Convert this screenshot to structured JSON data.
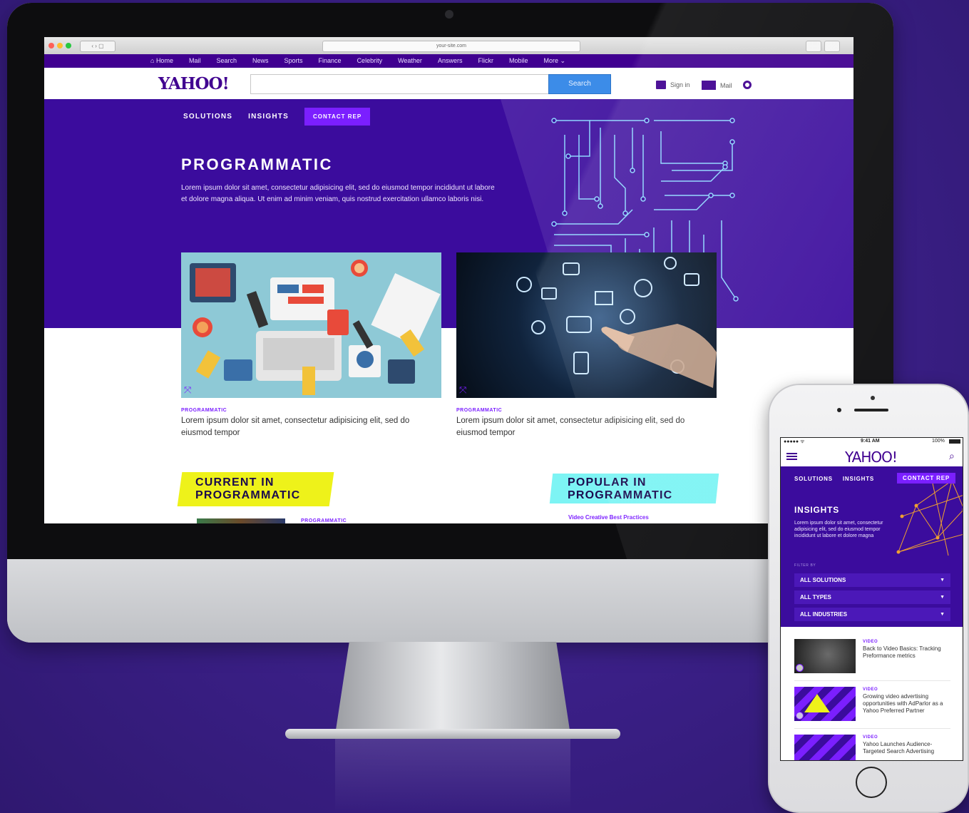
{
  "colors": {
    "brand_purple": "#400090",
    "hero_purple": "#3b0c9d",
    "accent_violet": "#7b1fff",
    "search_blue": "#3c8ce8",
    "highlight_yellow": "#eef21a",
    "highlight_cyan": "#7df4f4"
  },
  "desktop": {
    "browser": {
      "url": "your-site.com"
    },
    "yahoo_nav": {
      "items": [
        "Home",
        "Mail",
        "Search",
        "News",
        "Sports",
        "Finance",
        "Celebrity",
        "Weather",
        "Answers",
        "Flickr",
        "Mobile",
        "More ⌄"
      ]
    },
    "header": {
      "logo": "YAHOO!",
      "search_placeholder": "",
      "search_button": "Search",
      "sign_in": "Sign in",
      "mail": "Mail"
    },
    "subnav": {
      "solutions": "SOLUTIONS",
      "insights": "INSIGHTS",
      "contact": "CONTACT REP"
    },
    "hero": {
      "title": "PROGRAMMATIC",
      "body": "Lorem ipsum dolor sit amet, consectetur adipisicing elit, sed do eiusmod tempor incididunt ut labore et dolore magna aliqua. Ut enim ad minim veniam, quis nostrud exercitation ullamco laboris nisi."
    },
    "cards": [
      {
        "tag": "PROGRAMMATIC",
        "desc": "Lorem ipsum dolor sit amet, consectetur adipisicing elit, sed do eiusmod tempor"
      },
      {
        "tag": "PROGRAMMATIC",
        "desc": "Lorem ipsum dolor sit amet, consectetur adipisicing elit, sed do eiusmod tempor"
      }
    ],
    "current": {
      "title_1": "CURRENT IN",
      "title_2": "PROGRAMMATIC",
      "item_tag": "PROGRAMMATIC"
    },
    "popular": {
      "title_1": "POPULAR IN",
      "title_2": "PROGRAMMATIC",
      "first_link": "Video Creative Best Practices"
    }
  },
  "mobile": {
    "status": {
      "carrier": "●●●●● ᯤ",
      "time": "9:41 AM",
      "battery": "100%"
    },
    "logo": "YAHOO!",
    "subnav": {
      "solutions": "SOLUTIONS",
      "insights": "INSIGHTS",
      "contact": "CONTACT REP"
    },
    "hero": {
      "title": "INSIGHTS",
      "body": "Lorem ipsum dolor sit amet, consectetur adipisicing elit, sed do eiusmod tempor incididunt ut labore et dolore magna"
    },
    "filter": {
      "label": "FILTER BY",
      "options": [
        "ALL SOLUTIONS",
        "ALL TYPES",
        "ALL INDUSTRIES"
      ]
    },
    "items": [
      {
        "tag": "VIDEO",
        "title": "Back to Video Basics: Tracking Preformance metrics"
      },
      {
        "tag": "VIDEO",
        "title": "Growing video advertising opportunities with AdParlor as a Yahoo Preferred Partner"
      },
      {
        "tag": "VIDEO",
        "title": "Yahoo Launches Audience-Targeted Search Advertising"
      }
    ]
  }
}
